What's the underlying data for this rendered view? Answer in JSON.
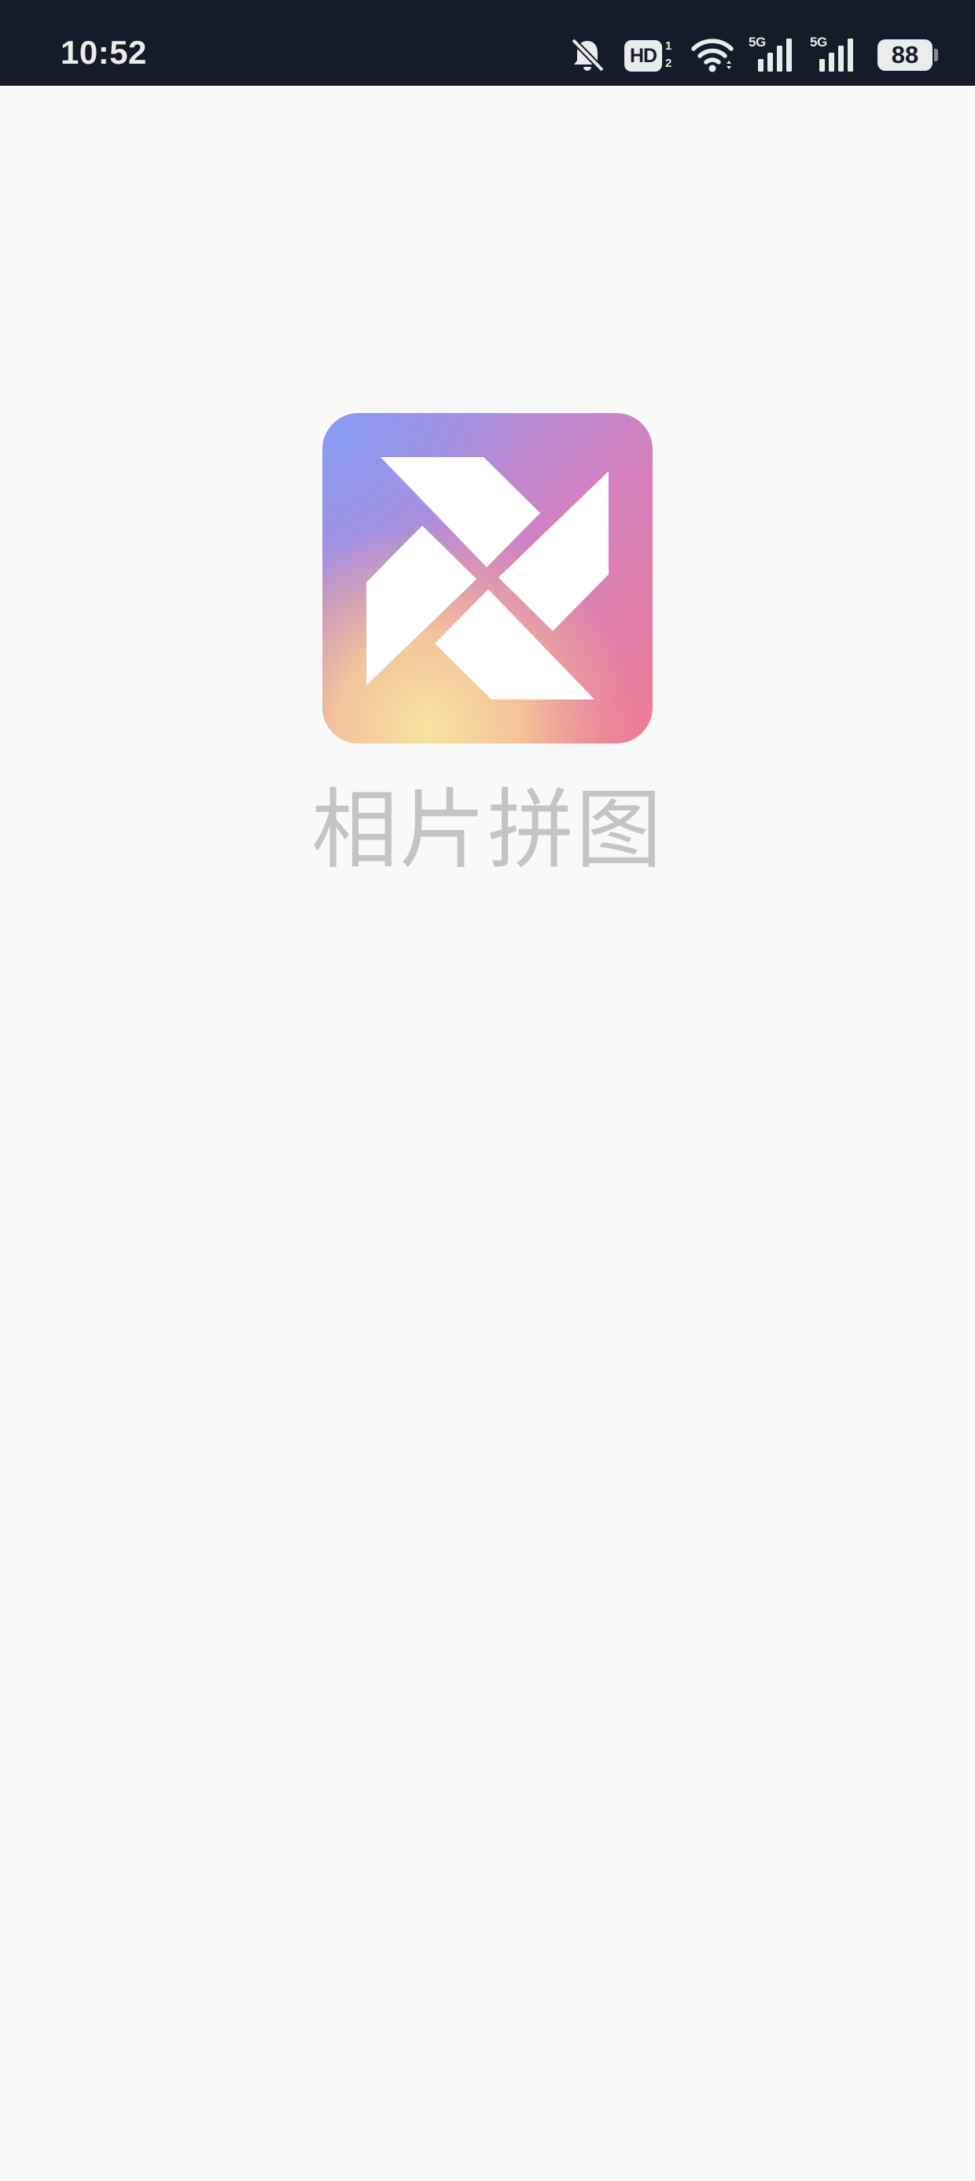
{
  "status_bar": {
    "time": "10:52",
    "hd_label": "HD",
    "hd_sim_top": "1",
    "hd_sim_bottom": "2",
    "sim1_network": "5G",
    "sim2_network": "5G",
    "battery_level": "88",
    "icons": [
      "bell-muted-icon",
      "hd-voice-icon",
      "wifi-icon",
      "signal-icon",
      "signal-icon",
      "battery-icon"
    ]
  },
  "splash": {
    "app_name": "相片拼图",
    "logo_icon": "pinwheel-icon"
  },
  "colors": {
    "status_bar_bg": "#171a28",
    "status_text": "#ebebeb",
    "page_bg": "#f9f9f9",
    "app_name_text": "#c4c4c4",
    "logo_gradient": [
      "#8d9af0",
      "#b785dc",
      "#ee7e9c",
      "#f7d898"
    ]
  }
}
